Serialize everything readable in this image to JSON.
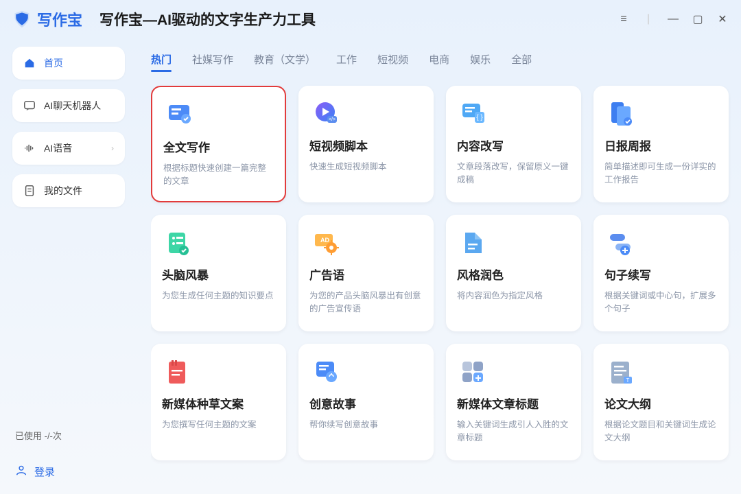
{
  "brand": "写作宝",
  "app_title": "写作宝—AI驱动的文字生产力工具",
  "sidebar": {
    "items": [
      {
        "label": "首页",
        "active": true
      },
      {
        "label": "AI聊天机器人"
      },
      {
        "label": "AI语音",
        "hasChevron": true
      },
      {
        "label": "我的文件"
      }
    ],
    "usage": "已使用 -/-次",
    "login": "登录"
  },
  "tabs": [
    {
      "label": "热门",
      "active": true
    },
    {
      "label": "社媒写作"
    },
    {
      "label": "教育（文学）"
    },
    {
      "label": "工作"
    },
    {
      "label": "短视频"
    },
    {
      "label": "电商"
    },
    {
      "label": "娱乐"
    },
    {
      "label": "全部"
    }
  ],
  "cards": [
    {
      "title": "全文写作",
      "desc": "根据标题快速创建一篇完整的文章",
      "highlight": true
    },
    {
      "title": "短视频脚本",
      "desc": "快速生成短视频脚本"
    },
    {
      "title": "内容改写",
      "desc": "文章段落改写，保留原义一键成稿"
    },
    {
      "title": "日报周报",
      "desc": "简单描述即可生成一份详实的工作报告"
    },
    {
      "title": "头脑风暴",
      "desc": "为您生成任何主题的知识要点"
    },
    {
      "title": "广告语",
      "desc": "为您的产品头脑风暴出有创意的广告宣传语"
    },
    {
      "title": "风格润色",
      "desc": "将内容润色为指定风格"
    },
    {
      "title": "句子续写",
      "desc": "根据关键词或中心句，扩展多个句子"
    },
    {
      "title": "新媒体种草文案",
      "desc": "为您撰写任何主题的文案"
    },
    {
      "title": "创意故事",
      "desc": "帮你续写创意故事"
    },
    {
      "title": "新媒体文章标题",
      "desc": "输入关键词生成引人入胜的文章标题"
    },
    {
      "title": "论文大纲",
      "desc": "根据论文题目和关键词生成论文大纲"
    }
  ]
}
